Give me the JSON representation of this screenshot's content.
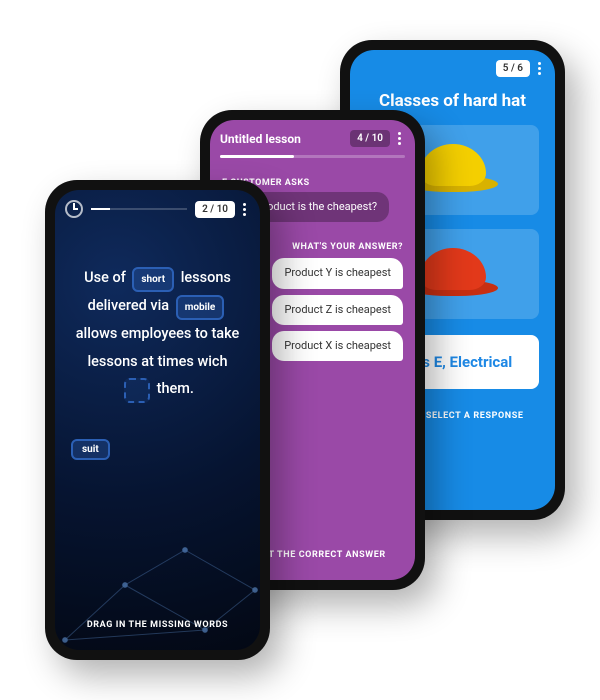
{
  "phone1": {
    "pager": "2 / 10",
    "sentence": {
      "s1": "Use of",
      "b1": "short",
      "s2": "lessons delivered via",
      "b2": "mobile",
      "s3": "allows employees to take lessons at times wich",
      "s4": "them."
    },
    "chip": "suit",
    "hint": "DRAG IN THE MISSING WORDS"
  },
  "phone2": {
    "title": "Untitled lesson",
    "pager": "4 / 10",
    "question_label": "E CUSTOMER ASKS",
    "question": "hich product is the cheapest?",
    "answer_label": "WHAT'S YOUR ANSWER?",
    "options": {
      "o1": "Product Y is cheapest",
      "o2": "Product Z is cheapest",
      "o3": "Product X is cheapest"
    },
    "hint": "SELECT THE CORRECT ANSWER"
  },
  "phone3": {
    "pager": "5 / 6",
    "title": "Classes of hard hat",
    "answer": "Class E, Electrical",
    "hint": "DRAG TO SELECT A RESPONSE"
  }
}
